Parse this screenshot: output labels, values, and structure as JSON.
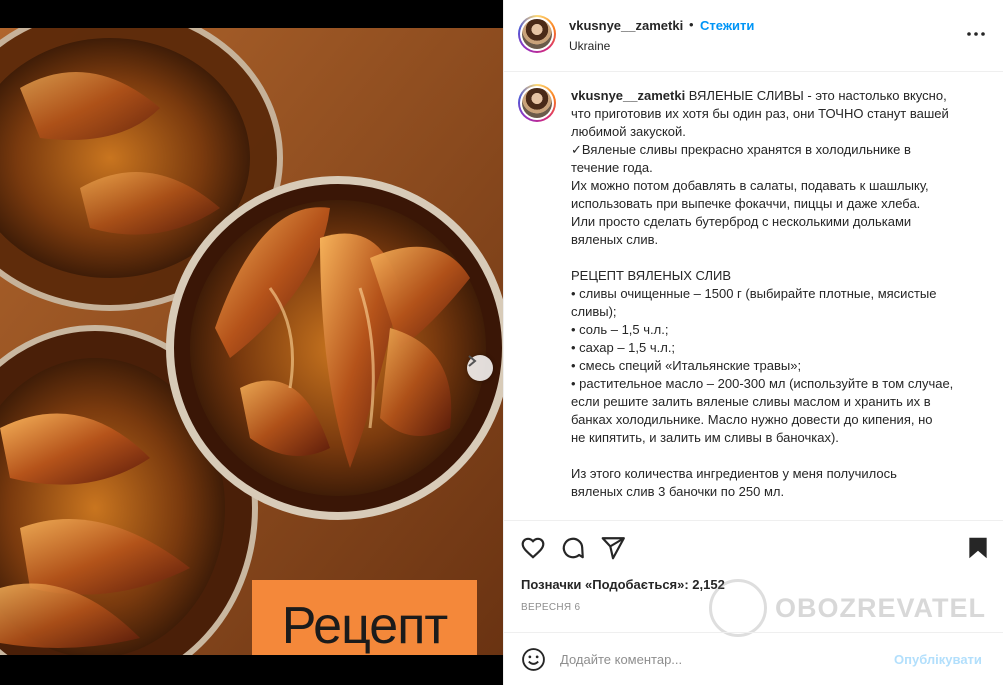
{
  "post": {
    "image_overlay_text": "Рецепт",
    "carousel_total": 5,
    "carousel_active": 1
  },
  "header": {
    "username": "vkusnye__zametki",
    "separator": "•",
    "follow_label": "Стежити",
    "location": "Ukraine"
  },
  "caption": {
    "username": "vkusnye__zametki",
    "text": " ВЯЛЕНЫЕ СЛИВЫ - это настолько вкусно,\nчто приготовив их хотя бы один раз, они ТОЧНО станут вашей\nлюбимой закуской.\n✓Вяленые сливы прекрасно хранятся в холодильнике в\nтечение года.\nИх можно потом добавлять в салаты, подавать к шашлыку,\nиспользовать при выпечке фокаччи, пиццы и даже хлеба.\nИли просто сделать бутерброд с несколькими дольками\nвяленых слив.\n\nРЕЦЕПТ ВЯЛЕНЫХ СЛИВ\n• сливы очищенные – 1500 г (выбирайте плотные, мясистые\nсливы);\n• соль – 1,5 ч.л.;\n• сахар – 1,5 ч.л.;\n• смесь специй «Итальянские травы»;\n• растительное масло – 200-300 мл (используйте в том случае,\nесли решите залить вяленые сливы маслом и хранить их в\nбанках холодильнике. Масло нужно довести до кипения, но\nне кипятить, и залить им сливы в баночках).\n\nИз этого количества ингредиентов у меня получилось\nвяленых слив 3 баночки по 250 мл."
  },
  "engagement": {
    "likes_text": "Позначки «Подобається»: 2,152",
    "date": "ВЕРЕСНЯ 6"
  },
  "watermark": {
    "text": "OBOZREVATEL"
  },
  "comment": {
    "placeholder": "Додайте коментар...",
    "publish_label": "Опублікувати"
  },
  "icons": {
    "like": "heart-icon",
    "comment": "comment-icon",
    "share": "paper-plane-icon",
    "save": "bookmark-icon",
    "more": "more-dots-icon",
    "emoji": "emoji-icon",
    "next": "chevron-right-icon"
  },
  "colors": {
    "link_blue": "#0095f6",
    "publish_disabled": "#b2dffc",
    "recipe_tag_bg": "#f4883a"
  }
}
